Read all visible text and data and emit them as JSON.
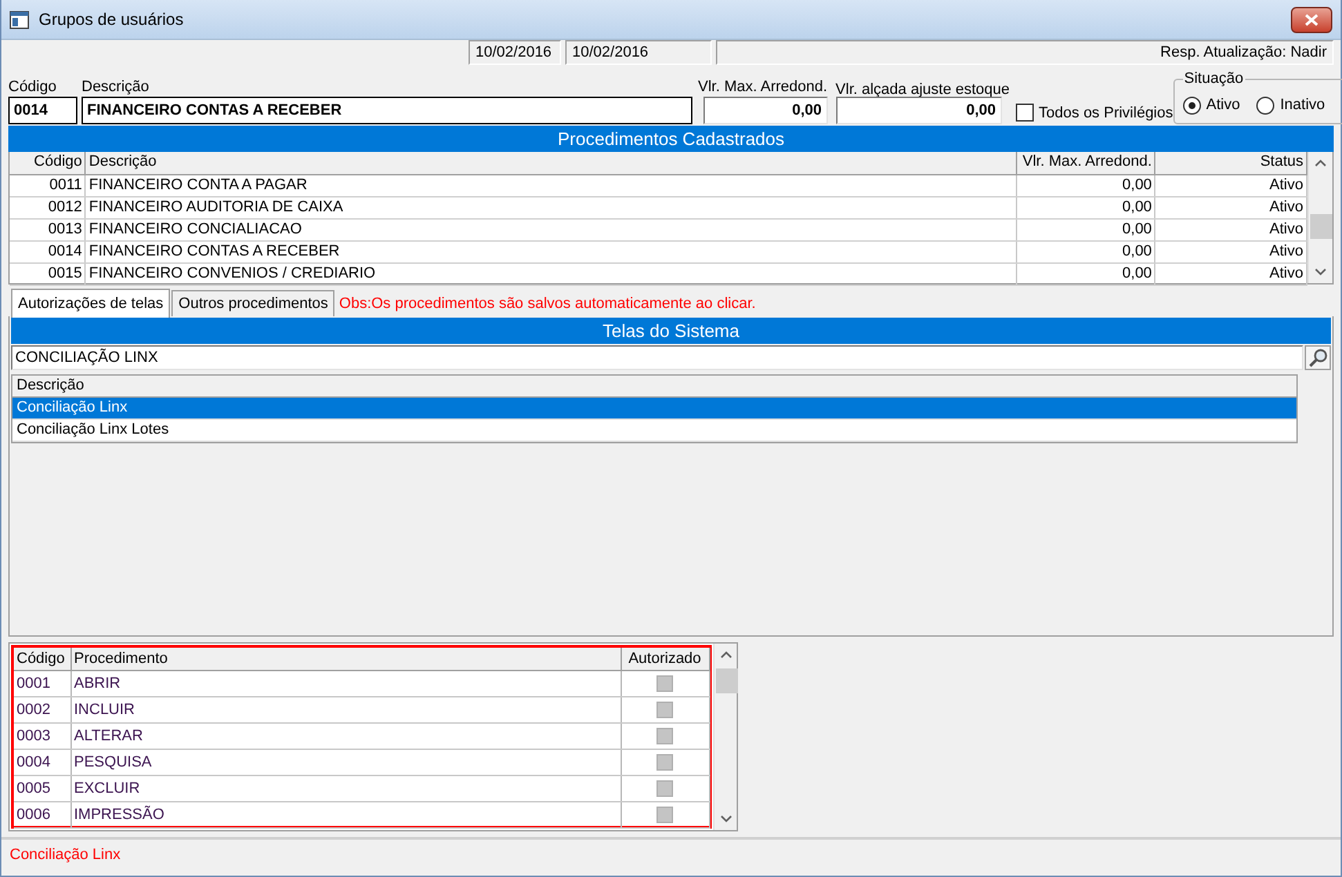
{
  "window": {
    "title": "Grupos de usuários"
  },
  "header_info": {
    "date_1": "10/02/2016",
    "date_2": "10/02/2016",
    "updated_by": "Resp. Atualização: Nadir"
  },
  "form": {
    "codigo": {
      "label": "Código",
      "value": "0014"
    },
    "descricao": {
      "label": "Descrição",
      "value": "FINANCEIRO CONTAS A RECEBER"
    },
    "vlr_max": {
      "label": "Vlr. Max. Arredond.",
      "value": "0,00"
    },
    "vlr_alcada": {
      "label": "Vlr. alçada ajuste estoque",
      "value": "0,00"
    },
    "all_privileges": {
      "label": "Todos os Privilégios",
      "checked": false
    },
    "situacao": {
      "label": "Situação",
      "options": [
        {
          "label": "Ativo",
          "selected": true
        },
        {
          "label": "Inativo",
          "selected": false
        }
      ]
    }
  },
  "procedures": {
    "title": "Procedimentos Cadastrados",
    "columns": [
      "Código",
      "Descrição",
      "Vlr. Max. Arredond.",
      "Status"
    ],
    "rows": [
      [
        "0011",
        "FINANCEIRO CONTA A PAGAR",
        "0,00",
        "Ativo"
      ],
      [
        "0012",
        "FINANCEIRO AUDITORIA DE CAIXA",
        "0,00",
        "Ativo"
      ],
      [
        "0013",
        "FINANCEIRO CONCIALIACAO",
        "0,00",
        "Ativo"
      ],
      [
        "0014",
        "FINANCEIRO CONTAS A RECEBER",
        "0,00",
        "Ativo"
      ],
      [
        "0015",
        "FINANCEIRO CONVENIOS / CREDIARIO",
        "0,00",
        "Ativo"
      ]
    ]
  },
  "tabs": [
    {
      "label": "Autorizações de telas",
      "selected": true
    },
    {
      "label": "Outros procedimentos",
      "selected": false
    }
  ],
  "note": "Obs:Os procedimentos são salvos automaticamente ao clicar.",
  "screens": {
    "title": "Telas do Sistema",
    "search": {
      "value": "CONCILIAÇÃO LINX"
    },
    "list_column": "Descrição",
    "items": [
      {
        "label": "Conciliação Linx",
        "selected": true
      },
      {
        "label": "Conciliação Linx Lotes",
        "selected": false
      }
    ]
  },
  "permissions": {
    "highlighted": true,
    "columns": [
      "Código",
      "Procedimento",
      "Autorizado"
    ],
    "rows": [
      {
        "code": "0001",
        "name": "ABRIR",
        "authorized": false
      },
      {
        "code": "0002",
        "name": "INCLUIR",
        "authorized": false
      },
      {
        "code": "0003",
        "name": "ALTERAR",
        "authorized": false
      },
      {
        "code": "0004",
        "name": "PESQUISA",
        "authorized": false
      },
      {
        "code": "0005",
        "name": "EXCLUIR",
        "authorized": false
      },
      {
        "code": "0006",
        "name": "IMPRESSÃO",
        "authorized": false
      }
    ]
  },
  "status_bar": "Conciliação Linx"
}
